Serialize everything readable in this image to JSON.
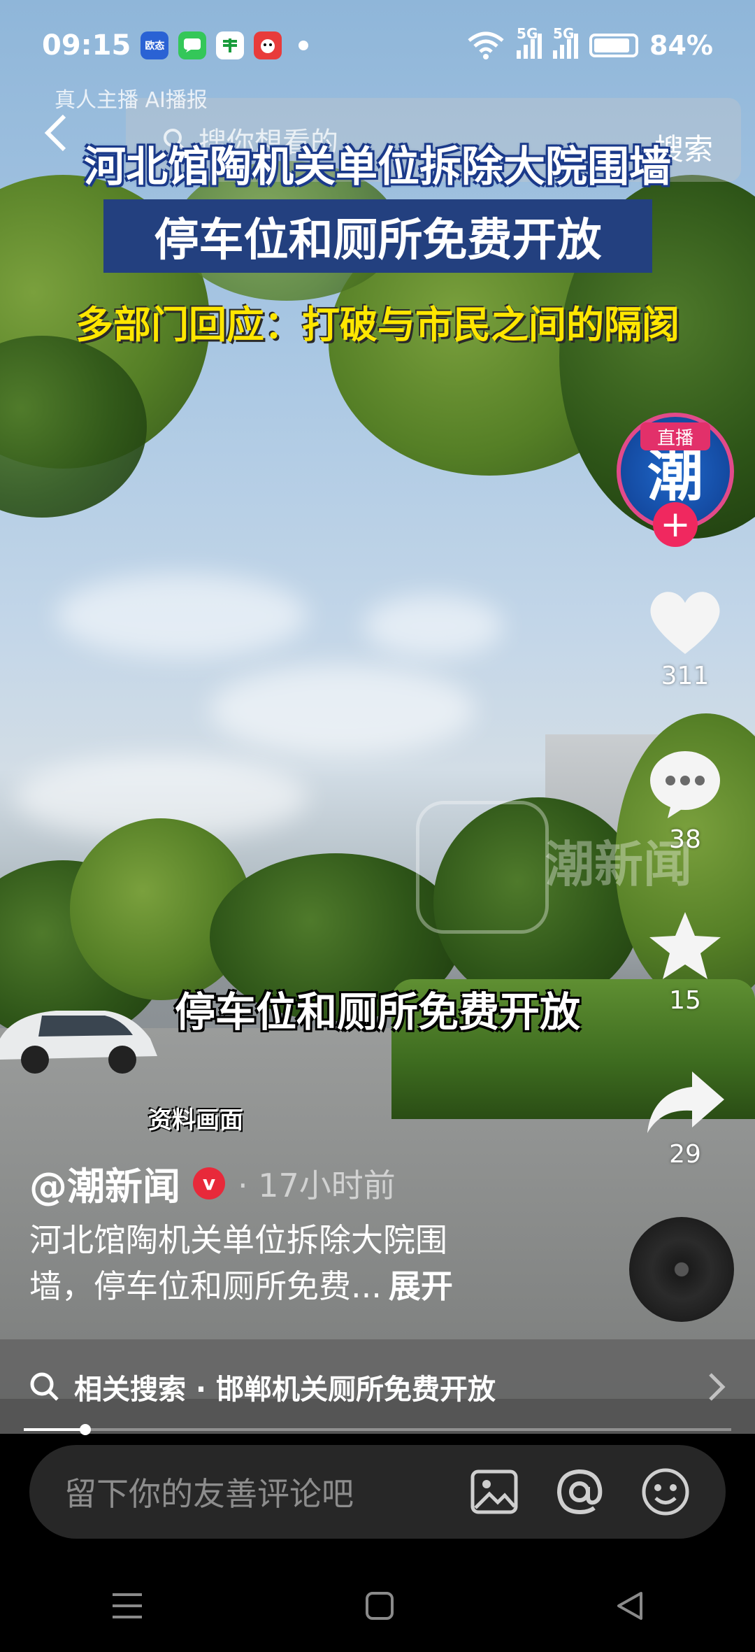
{
  "status_bar": {
    "time": "09:15",
    "app_icons": [
      {
        "name": "欧态",
        "color": "#2a62d4"
      },
      {
        "name": "messages-icon",
        "color": "#34c759"
      },
      {
        "name": "postal-icon",
        "color": "#ffffff"
      },
      {
        "name": "app-icon",
        "color": "#e83b3b"
      }
    ],
    "network_1": "5G",
    "network_2": "5G",
    "battery": "84%"
  },
  "top": {
    "ai_label": "真人主播 AI播报",
    "search_placeholder": "搜你想看的",
    "search_action": "搜索"
  },
  "video": {
    "headline_1": "河北馆陶机关单位拆除大院围墙",
    "headline_2": "停车位和厕所免费开放",
    "headline_3": "多部门回应：打破与市民之间的隔阂",
    "watermark": "潮新闻",
    "caption_main": "停车位和厕所免费开放",
    "caption_source": "资料画面"
  },
  "rail": {
    "live_badge": "直播",
    "avatar_text": "潮",
    "follow": "+",
    "likes": "311",
    "comments": "38",
    "favorites": "15",
    "shares": "29"
  },
  "post": {
    "author": "@潮新闻",
    "verified_mark": "v",
    "time": "· 17小时前",
    "description_line1": "河北馆陶机关单位拆除大院围",
    "description_line2": "墙，停车位和厕所免费...",
    "expand": "展开"
  },
  "related": {
    "text": "相关搜索 · 邯郸机关厕所免费开放"
  },
  "progress": {
    "fraction": 0.087
  },
  "comment": {
    "placeholder": "留下你的友善评论吧"
  },
  "colors": {
    "accent_pink": "#f0285f",
    "headline_blue": "#23407f",
    "headline_yellow": "#ffe600"
  }
}
